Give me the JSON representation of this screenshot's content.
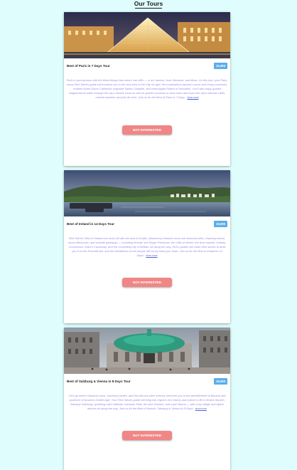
{
  "page": {
    "title": "Our Tours"
  },
  "colors": {
    "background": "#dffdfc",
    "price_badge": "#5aaee9",
    "button": "#f08686",
    "description_text": "#9b8cdf"
  },
  "tours": [
    {
      "name": "Best of Paris in 7 Days Tour",
      "price": "$1,995",
      "description": "Paris is synonymous with the finest things that culture can offer — in art, fashion, food, literature, and ideas. On this tour, your Paris-savvy Rick Steves guide will immerse you in the very best of the City of Light: the masterpiece-packed Louvre and Orsay museums, resilient Notre-Dame Cathedral, exquisite Sainte-Chapelle, and extravagant Palace of Versailles. You'll also enjoy guided neighborhood walks through the city's historic heart as well as quieter moments to slow down and savor the city's intimate cafés, colorful markets, and joie de vivre. Join us for the Best of Paris in 7 Days!",
      "show_more": "show more",
      "button": "NOT INTERESTED",
      "image_alt": "Louvre pyramid at night"
    },
    {
      "name": "Best of Ireland in 14 Days Tour",
      "price": "$3,895",
      "description": "Rick Steves' Best of Ireland tour kicks off with the best of Dublin, followed by Ireland's must-see historical sites, charming towns, music-filled pubs, and seaside getaways — including Kinsale, the Dingle Peninsula, the Cliffs of Moher, the Aran Islands, Galway, Connemara, Giant's Causeway, and the compelling city of Belfast. All along the way, Rick's guides will share their stories to draw you in to the Emerald Isle, and the friendliness of the people will surely steal your heart. Join us for the Best of Ireland in 14 Days!",
      "show_more": "show more",
      "button": "NOT INTERESTED",
      "image_alt": "Irish coastal town at dusk"
    },
    {
      "name": "Best of Salzburg & Vienna in 8 Days Tour",
      "price": "$2,695",
      "description": "Let's go where classical music, towering castles, and the-hills-are-alive scenery welcome you to the gemütlichkeit of Bavaria and opulence of Austria's Golden Age. Your Rick Steves guide will bring this region's rich history and culture to life in festive Munich, Baroque Salzburg, sparkling Lake Hallstatt, monastic Melk, the blue Danube, and royal Vienna — with cozy village and alpine detours all along the way. Join us for the Best of Munich, Salzburg & Vienna in 8 Days!",
      "show_more": "show more",
      "button": "NOT INTERESTED",
      "image_alt": "Vienna palace with green dome"
    }
  ]
}
